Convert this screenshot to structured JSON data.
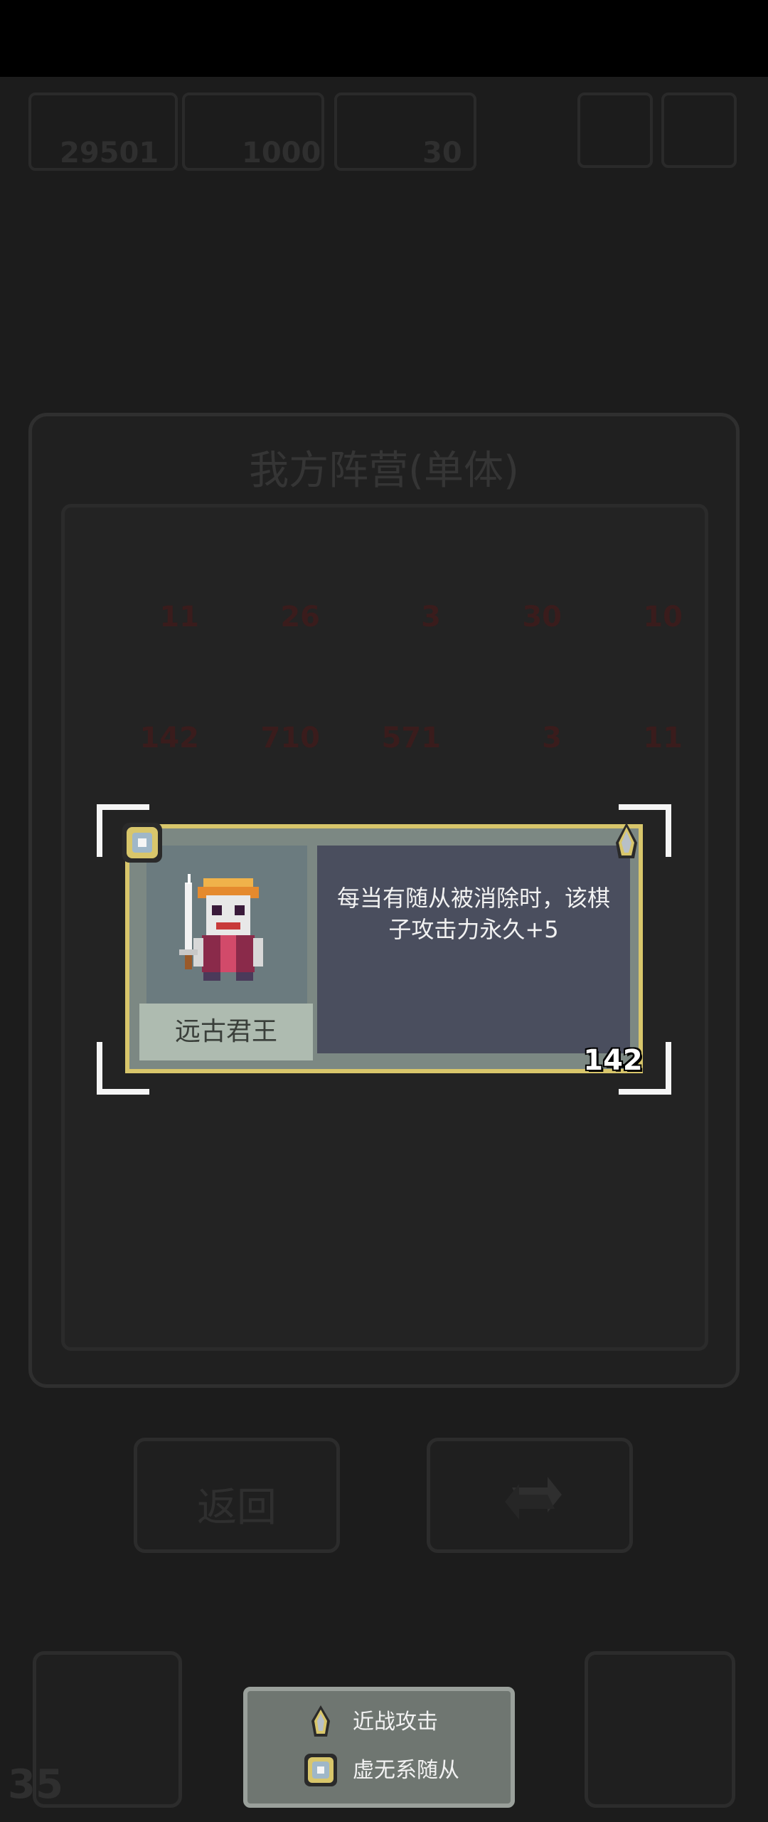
{
  "top_bar": {
    "gold": "29501",
    "gems": "1000",
    "energy": "30"
  },
  "panel": {
    "title": "我方阵营(单体)"
  },
  "units": [
    {
      "level": "11"
    },
    {
      "level": "26"
    },
    {
      "level": "3"
    },
    {
      "level": "30"
    },
    {
      "level": "10"
    },
    {
      "level": "142"
    },
    {
      "level": "710"
    },
    {
      "level": "571"
    },
    {
      "level": "3"
    },
    {
      "level": "11"
    }
  ],
  "buttons": {
    "back_label": "返回"
  },
  "bottom": {
    "count": "35"
  },
  "card": {
    "name": "远古君王",
    "description_line1": "每当有随从被消除时，该棋",
    "description_line2": "子攻击力永久+5",
    "level": "142"
  },
  "legend": {
    "items": [
      {
        "icon": "spike-icon",
        "label": "近战攻击"
      },
      {
        "icon": "void-icon",
        "label": "虚无系随从"
      }
    ]
  },
  "colors": {
    "card_border": "#d8c66b",
    "card_body": "#4a4e5e",
    "name_bar": "#aebbb0"
  }
}
